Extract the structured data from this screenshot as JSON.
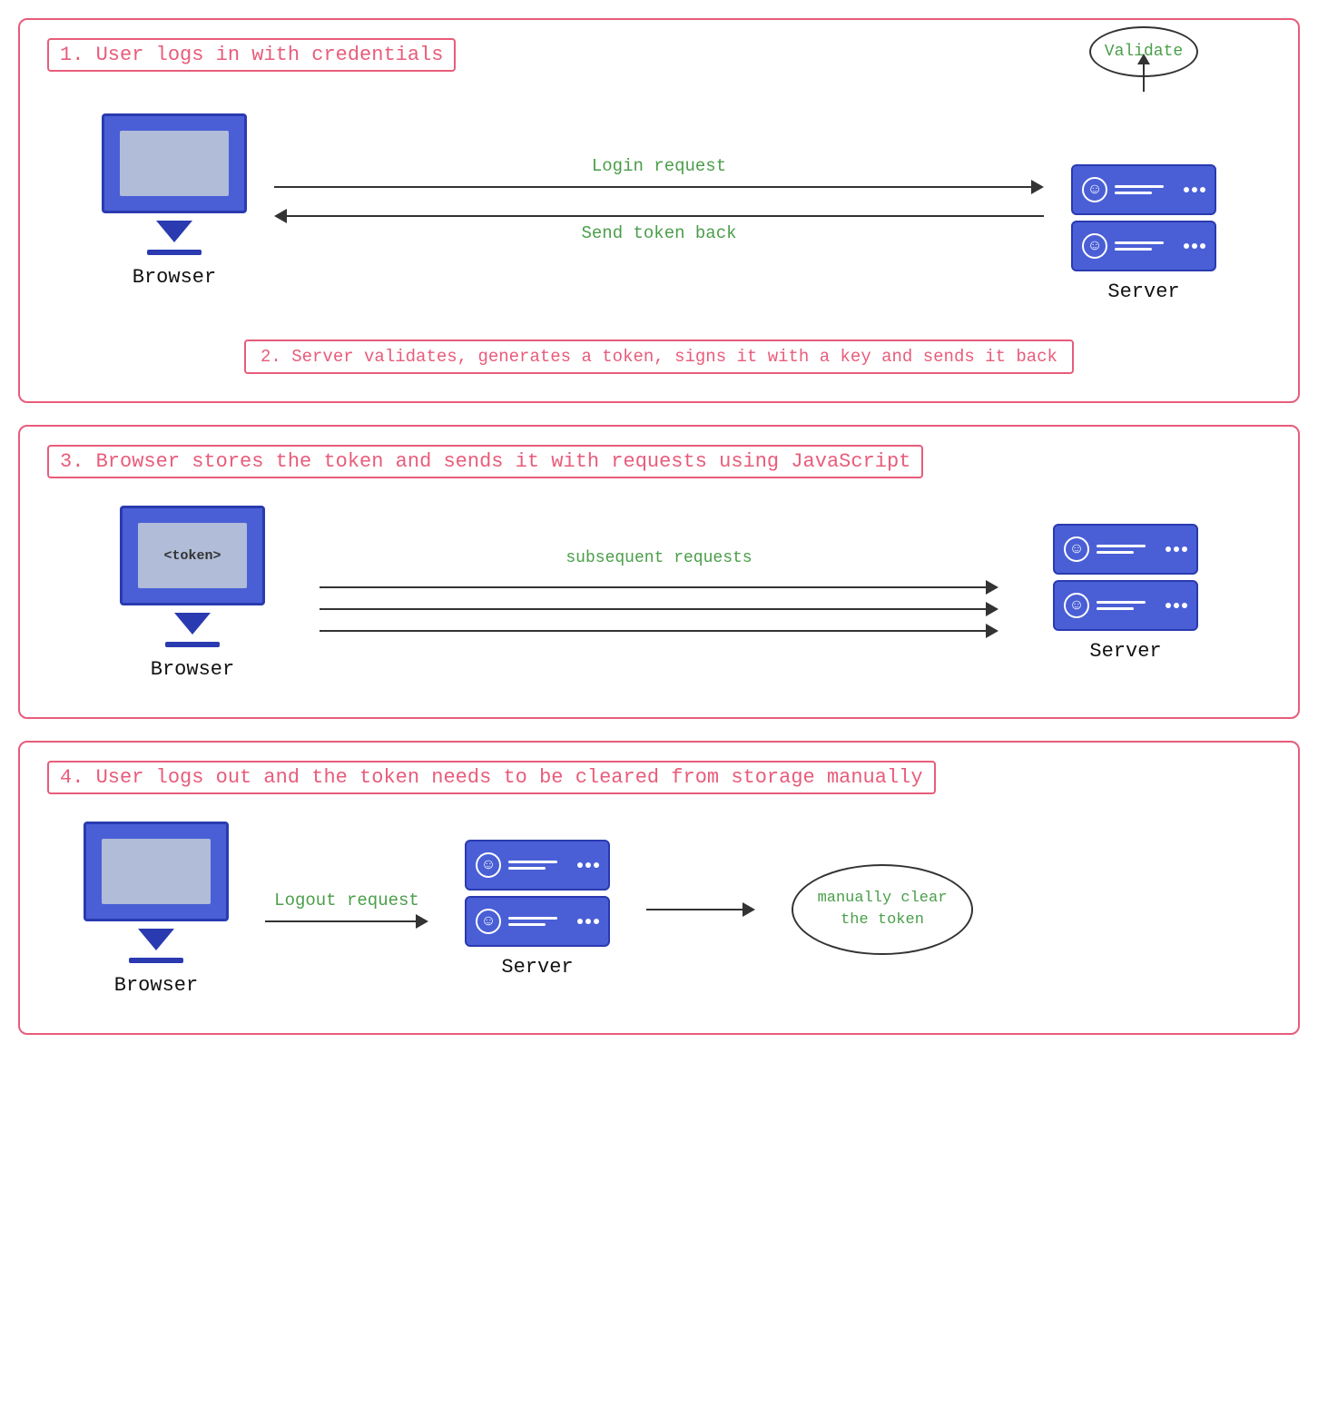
{
  "panels": [
    {
      "id": "panel1",
      "label": "1. User logs in with credentials",
      "login_request": "Login request",
      "send_token_back": "Send token back",
      "browser_label": "Browser",
      "server_label": "Server",
      "validate_label": "Validate",
      "note": "2. Server validates, generates a token, signs it with a key and sends it back"
    },
    {
      "id": "panel3",
      "label": "3. Browser stores the token and sends it with requests using JavaScript",
      "subsequent": "subsequent requests",
      "browser_label": "Browser",
      "server_label": "Server",
      "token_display": "<token>"
    },
    {
      "id": "panel4",
      "label": "4. User logs out and the token needs to be cleared from storage manually",
      "logout_request": "Logout request",
      "browser_label": "Browser",
      "server_label": "Server",
      "manually_clear": "manually clear\nthe token"
    }
  ]
}
